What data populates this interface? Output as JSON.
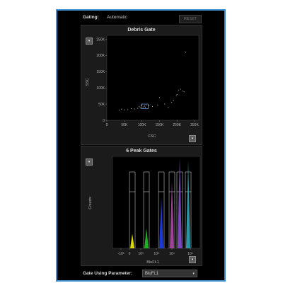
{
  "gating": {
    "label": "Gating:",
    "value": "Automatic",
    "reset_label": "RESET"
  },
  "debris_gate": {
    "title": "Debris Gate",
    "xlabel": "FSC",
    "ylabel": "SSC",
    "x_ticks": [
      "0",
      "50K",
      "100K",
      "150K",
      "200K",
      "250K"
    ],
    "y_ticks": [
      "0",
      "50K",
      "100K",
      "150K",
      "200K",
      "250K"
    ],
    "dropdown_symbol": "▾"
  },
  "peak_gates": {
    "title": "6 Peak Gates",
    "xlabel": "BluFL1",
    "ylabel": "Counts",
    "x_ticks": [
      "-10³",
      "0",
      "10³",
      "10³",
      "10⁴",
      "10⁵"
    ],
    "dropdown_symbol": "▾"
  },
  "gate_param": {
    "label": "Gate Using Parameter:",
    "value": "BluFL1",
    "arrow": "▾"
  },
  "chart_data": [
    {
      "type": "scatter",
      "title": "Debris Gate",
      "xlabel": "FSC",
      "ylabel": "SSC",
      "xlim": [
        0,
        262144
      ],
      "ylim": [
        0,
        262144
      ],
      "points": [
        {
          "x": 106000,
          "y": 42000
        },
        {
          "x": 110000,
          "y": 40000
        },
        {
          "x": 103000,
          "y": 39000
        },
        {
          "x": 108000,
          "y": 44000
        },
        {
          "x": 95000,
          "y": 38000
        },
        {
          "x": 88000,
          "y": 37000
        },
        {
          "x": 80000,
          "y": 35000
        },
        {
          "x": 70000,
          "y": 36000
        },
        {
          "x": 60000,
          "y": 33000
        },
        {
          "x": 50000,
          "y": 32000
        },
        {
          "x": 42000,
          "y": 34000
        },
        {
          "x": 35000,
          "y": 31000
        },
        {
          "x": 120000,
          "y": 45000
        },
        {
          "x": 130000,
          "y": 43000
        },
        {
          "x": 145000,
          "y": 46000
        },
        {
          "x": 165000,
          "y": 50000
        },
        {
          "x": 185000,
          "y": 55000
        },
        {
          "x": 200000,
          "y": 80000
        },
        {
          "x": 205000,
          "y": 92000
        },
        {
          "x": 210000,
          "y": 96000
        },
        {
          "x": 215000,
          "y": 90000
        },
        {
          "x": 198000,
          "y": 75000
        },
        {
          "x": 220000,
          "y": 88000
        },
        {
          "x": 190000,
          "y": 60000
        },
        {
          "x": 225000,
          "y": 210000
        },
        {
          "x": 112000,
          "y": 47000
        },
        {
          "x": 100000,
          "y": 45000
        },
        {
          "x": 92000,
          "y": 42000
        },
        {
          "x": 150000,
          "y": 70000
        },
        {
          "x": 175000,
          "y": 40000
        }
      ],
      "gate": {
        "x": [
          98000,
          118000
        ],
        "y": [
          36000,
          50000
        ]
      }
    },
    {
      "type": "histogram",
      "title": "6 Peak Gates",
      "xlabel": "BluFL1",
      "ylabel": "Counts",
      "peaks": [
        {
          "color": "#f2f200",
          "rel_height": 0.16
        },
        {
          "color": "#22c422",
          "rel_height": 0.22
        },
        {
          "color": "#1f3df0",
          "rel_height": 0.55
        },
        {
          "color": "#b04aa8",
          "rel_height": 0.72
        },
        {
          "color": "#8a4fd0",
          "rel_height": 0.98
        },
        {
          "color": "#2fa6b6",
          "rel_height": 0.95
        }
      ]
    }
  ]
}
